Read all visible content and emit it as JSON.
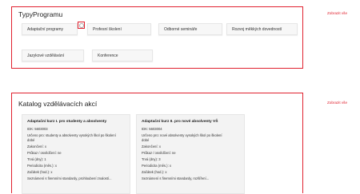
{
  "types": {
    "title": "TypyProgramu",
    "show_all": "Zobrazit vše",
    "chips": [
      "Adaptační programy",
      "Profesní školení",
      "Odborné semináře",
      "Rozvoj měkkých dovedností",
      "Jazykové vzdělávání",
      "Konference"
    ]
  },
  "catalog": {
    "title": "Katalog vzdělávacích akcí",
    "show_all": "Zobrazit vše",
    "cards": [
      {
        "title": "Adaptační kurz I. pro studenty a absolventy",
        "id": "IDK: 5603003",
        "desc1": "Určeno pro: studenty a absolventy vysokých škol po školení",
        "desc2": "dobé",
        "closing": "Zakončení: x",
        "certificate": "Průkaz / osvědčení: ne",
        "duration": "Trvá (dny): 1",
        "periodicity": "Periodicita (měs.): x",
        "start": "Začátek (hod.): x",
        "footer": "Seznámení s firemními standardy, prohloubení znalostí..."
      },
      {
        "title": "Adaptační kurz II. pro nové absolventy VŠ",
        "id": "IDK: 5603004",
        "desc1": "Určeno pro: nové absolventy vysokých škol po školení",
        "desc2": "dobé",
        "closing": "Zakončení: x",
        "certificate": "Průkaz / osvědčení: ne",
        "duration": "Trvá (dny): 3",
        "periodicity": "Periodicita (měs.): x",
        "start": "Začátek (hod.): x",
        "footer": "Seznámení s firemními standardy, rozšíření..."
      }
    ]
  }
}
